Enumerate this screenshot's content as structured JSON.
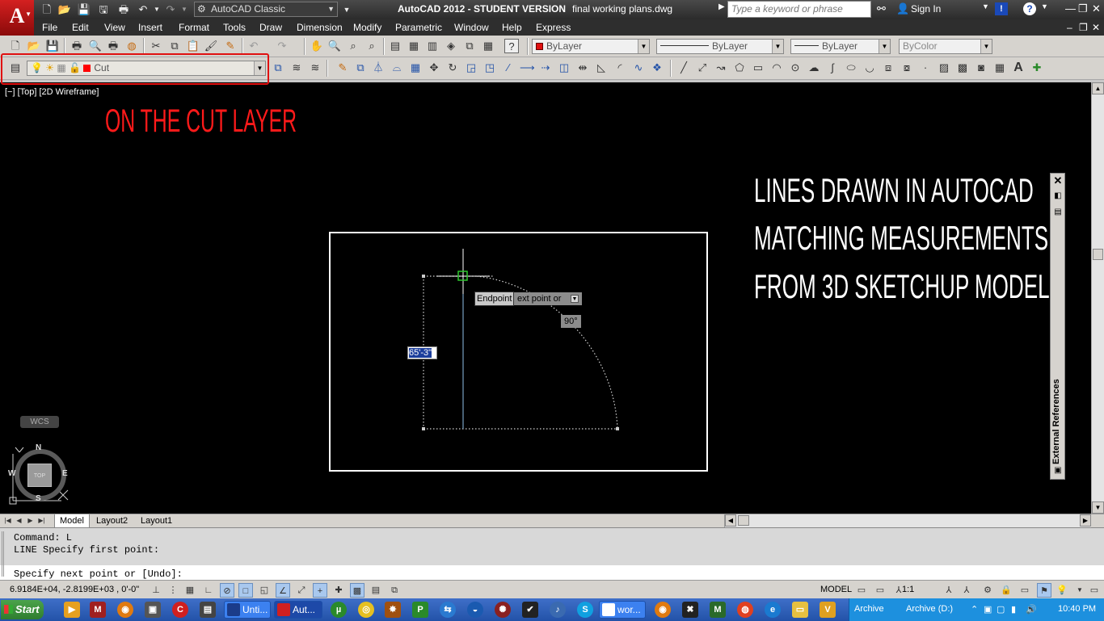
{
  "titlebar": {
    "workspace": "AutoCAD Classic",
    "app_title": "AutoCAD 2012 - STUDENT VERSION",
    "file_name": "final working plans.dwg",
    "search_placeholder": "Type a keyword or phrase",
    "sign_in": "Sign In"
  },
  "menu": {
    "items": [
      "File",
      "Edit",
      "View",
      "Insert",
      "Format",
      "Tools",
      "Draw",
      "Dimension",
      "Modify",
      "Parametric",
      "Window",
      "Help",
      "Express"
    ]
  },
  "properties": {
    "color": "ByLayer",
    "linetype": "ByLayer",
    "lineweight": "ByLayer",
    "plotstyle": "ByColor",
    "layer": "Cut",
    "layer_color": "#ff0000"
  },
  "viewport": {
    "label": "[−] [Top] [2D Wireframe]",
    "annotation_cut": "ON THE CUT LAYER",
    "annotation_lines": [
      "LINES DRAWN IN AUTOCAD",
      "MATCHING MEASUREMENTS",
      "FROM 3D SKETCHUP MODEL"
    ],
    "osnap_tooltip": "Endpoint",
    "prompt_tooltip": "ext point or",
    "angle_tooltip": "90°",
    "dimension_input": "65'-3\"",
    "wcs": "WCS",
    "viewcube": {
      "top": "TOP",
      "n": "N",
      "s": "S",
      "e": "E",
      "w": "W",
      "y_axis": "Y"
    }
  },
  "palette": {
    "title": "External References"
  },
  "layout_tabs": [
    "Model",
    "Layout2",
    "Layout1"
  ],
  "command": {
    "history": [
      "Command: L",
      "LINE Specify first point:"
    ],
    "current": "Specify next point or [Undo]:"
  },
  "status": {
    "coordinates": "6.9184E+04, -2.8199E+03 , 0'-0\"",
    "space": "MODEL",
    "annotation_scale": "1:1"
  },
  "taskbar": {
    "start": "Start",
    "tasks": [
      "Unti...",
      "Aut...",
      "wor..."
    ],
    "tray_archive": "Archive",
    "tray_drive": "Archive (D:)",
    "clock": "10:40 PM"
  }
}
